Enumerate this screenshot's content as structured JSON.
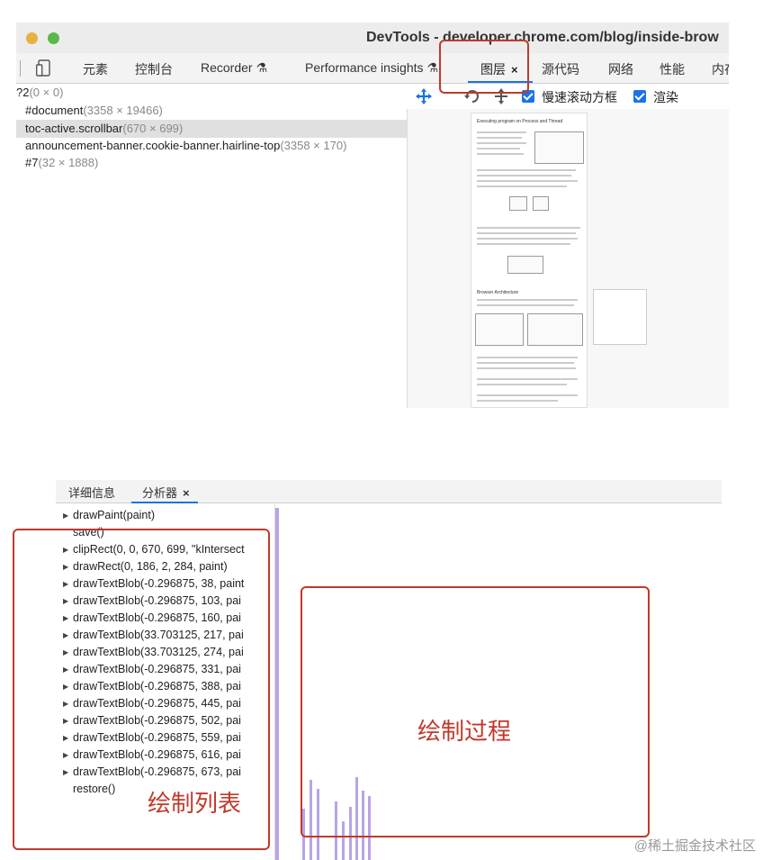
{
  "window": {
    "title": "DevTools - developer.chrome.com/blog/inside-brow"
  },
  "tabs": [
    {
      "label": "元素"
    },
    {
      "label": "控制台"
    },
    {
      "label": "Recorder"
    },
    {
      "label": "Performance insights"
    },
    {
      "label": "图层",
      "closable": true,
      "active": true
    },
    {
      "label": "源代码"
    },
    {
      "label": "网络"
    },
    {
      "label": "性能"
    },
    {
      "label": "内存"
    }
  ],
  "tab_close_glyph": "×",
  "layers_tree": [
    {
      "name": "?2",
      "size": "(0 × 0)"
    },
    {
      "name": "#document",
      "size": "(3358 × 19466)"
    },
    {
      "name": "toc-active.scrollbar",
      "size": "(670 × 699)",
      "selected": true
    },
    {
      "name": "announcement-banner.cookie-banner.hairline-top",
      "size": "(3358 × 170)"
    },
    {
      "name": "#7",
      "size": "(32 × 1888)"
    }
  ],
  "layer_toolbar": {
    "tools": [
      "move-icon",
      "rotate-icon",
      "reset-icon"
    ],
    "checkboxes": [
      {
        "label": "慢速滚动方框",
        "checked": true
      },
      {
        "label": "渲染",
        "checked": true
      }
    ]
  },
  "preview": {
    "heading1": "Executing program on Process and Thread",
    "heading2": "Browser Architecture"
  },
  "bottom_tabs": [
    {
      "label": "详细信息"
    },
    {
      "label": "分析器",
      "closable": true,
      "active": true
    }
  ],
  "commands": [
    {
      "text": "drawPaint(paint)",
      "expandable": true
    },
    {
      "text": "save()",
      "expandable": false
    },
    {
      "text": "clipRect(0, 0, 670, 699, \"kIntersect",
      "expandable": true
    },
    {
      "text": "drawRect(0, 186, 2, 284, paint)",
      "expandable": true
    },
    {
      "text": "drawTextBlob(-0.296875, 38, paint",
      "expandable": true
    },
    {
      "text": "drawTextBlob(-0.296875, 103, pai",
      "expandable": true
    },
    {
      "text": "drawTextBlob(-0.296875, 160, pai",
      "expandable": true
    },
    {
      "text": "drawTextBlob(33.703125, 217, pai",
      "expandable": true
    },
    {
      "text": "drawTextBlob(33.703125, 274, pai",
      "expandable": true
    },
    {
      "text": "drawTextBlob(-0.296875, 331, pai",
      "expandable": true
    },
    {
      "text": "drawTextBlob(-0.296875, 388, pai",
      "expandable": true
    },
    {
      "text": "drawTextBlob(-0.296875, 445, pai",
      "expandable": true
    },
    {
      "text": "drawTextBlob(-0.296875, 502, pai",
      "expandable": true
    },
    {
      "text": "drawTextBlob(-0.296875, 559, pai",
      "expandable": true
    },
    {
      "text": "drawTextBlob(-0.296875, 616, pai",
      "expandable": true
    },
    {
      "text": "drawTextBlob(-0.296875, 673, pai",
      "expandable": true
    },
    {
      "text": "restore()",
      "expandable": false
    }
  ],
  "annotations": {
    "paint_list": "绘制列表",
    "paint_process": "绘制过程"
  },
  "watermark": "@稀土掘金技术社区",
  "colors": {
    "accent": "#1a73e8",
    "annotation": "#c0392b",
    "timeline_bar": "#b9a4e6"
  }
}
